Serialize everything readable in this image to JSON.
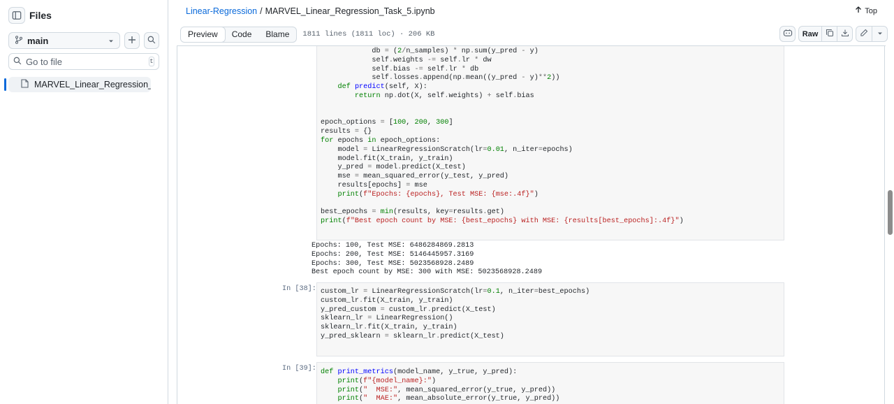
{
  "sidebar": {
    "title": "Files",
    "branch": "main",
    "goto_placeholder": "Go to file",
    "goto_shortcut": "t",
    "tree": [
      {
        "label": "MARVEL_Linear_Regression_Task..."
      }
    ]
  },
  "header": {
    "breadcrumb_repo": "Linear-Regression",
    "breadcrumb_sep": "/",
    "breadcrumb_file": "MARVEL_Linear_Regression_Task_5.ipynb",
    "top_label": "Top"
  },
  "toolbar": {
    "tabs": [
      "Preview",
      "Code",
      "Blame"
    ],
    "meta": "1811 lines (1811 loc) · 206 KB",
    "raw_label": "Raw"
  },
  "cells": {
    "cell_a_lines": [
      "            db = (2/n_samples) * np.sum(y_pred - y)",
      "            self.weights -= self.lr * dw",
      "            self.bias -= self.lr * db",
      "            self.losses.append(np.mean((y_pred - y)**2))",
      "    def predict(self, X):",
      "        return np.dot(X, self.weights) + self.bias",
      "",
      "",
      "epoch_options = [100, 200, 300]",
      "results = {}",
      "for epochs in epoch_options:",
      "    model = LinearRegressionScratch(lr=0.01, n_iter=epochs)",
      "    model.fit(X_train, y_train)",
      "    y_pred = model.predict(X_test)",
      "    mse = mean_squared_error(y_test, y_pred)",
      "    results[epochs] = mse",
      "    print(f\"Epochs: {epochs}, Test MSE: {mse:.4f}\")",
      "",
      "best_epochs = min(results, key=results.get)",
      "print(f\"Best epoch count by MSE: {best_epochs} with MSE: {results[best_epochs]:.4f}\")"
    ],
    "output_a": [
      "Epochs: 100, Test MSE: 6486284869.2813",
      "Epochs: 200, Test MSE: 5146445957.3169",
      "Epochs: 300, Test MSE: 5023568928.2489",
      "Best epoch count by MSE: 300 with MSE: 5023568928.2489"
    ],
    "prompt_38": "In [38]:",
    "cell_38_lines": [
      "custom_lr = LinearRegressionScratch(lr=0.1, n_iter=best_epochs)",
      "custom_lr.fit(X_train, y_train)",
      "y_pred_custom = custom_lr.predict(X_test)",
      "sklearn_lr = LinearRegression()",
      "sklearn_lr.fit(X_train, y_train)",
      "y_pred_sklearn = sklearn_lr.predict(X_test)"
    ],
    "prompt_39": "In [39]:",
    "cell_39_lines": [
      "def print_metrics(model_name, y_true, y_pred):",
      "    print(f\"{model_name}:\")",
      "    print(\"  MSE:\", mean_squared_error(y_true, y_pred))",
      "    print(\"  MAE:\", mean_absolute_error(y_true, y_pred))"
    ]
  },
  "icons": [
    "sidebar-toggle-icon",
    "branch-icon",
    "plus-icon",
    "search-icon",
    "file-icon",
    "arrow-up-icon",
    "copilot-icon",
    "copy-icon",
    "download-icon",
    "pencil-icon",
    "chevron-down-icon"
  ]
}
